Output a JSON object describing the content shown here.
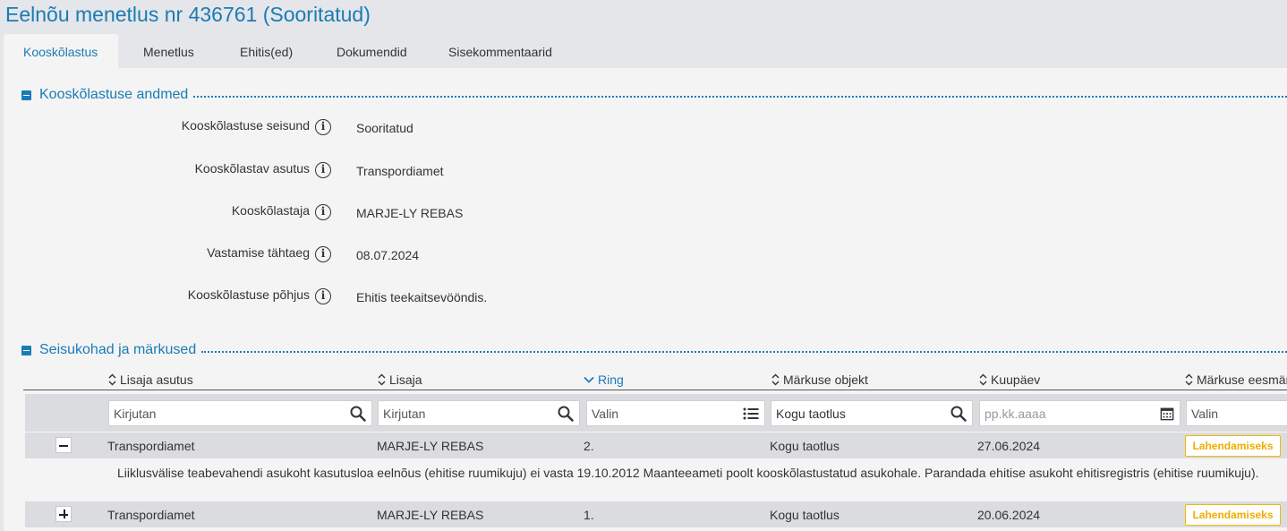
{
  "page": {
    "title": "Eelnõu menetlus nr 436761 (Sooritatud)"
  },
  "tabs": [
    {
      "label": "Kooskõlastus",
      "active": true
    },
    {
      "label": "Menetlus"
    },
    {
      "label": "Ehitis(ed)"
    },
    {
      "label": "Dokumendid"
    },
    {
      "label": "Sisekommentaarid"
    }
  ],
  "section_details": {
    "title": "Kooskõlastuse andmed",
    "fields": [
      {
        "label": "Kooskõlastuse seisund",
        "value": "Sooritatud"
      },
      {
        "label": "Kooskõlastav asutus",
        "value": "Transpordiamet"
      },
      {
        "label": "Kooskõlastaja",
        "value": "MARJE-LY REBAS"
      },
      {
        "label": "Vastamise tähtaeg",
        "value": "08.07.2024"
      },
      {
        "label": "Kooskõlastuse põhjus",
        "value": "Ehitis teekaitsevööndis."
      }
    ]
  },
  "section_remarks": {
    "title": "Seisukohad ja märkused",
    "columns": [
      {
        "label": "Lisaja asutus"
      },
      {
        "label": "Lisaja"
      },
      {
        "label": "Ring",
        "sorted": "desc"
      },
      {
        "label": "Märkuse objekt"
      },
      {
        "label": "Kuupäev"
      },
      {
        "label": "Märkuse eesmärk"
      }
    ],
    "filters": [
      {
        "placeholder": "Kirjutan",
        "icon": "search-icon"
      },
      {
        "placeholder": "Kirjutan",
        "icon": "search-icon"
      },
      {
        "placeholder": "Valin",
        "icon": "list-icon"
      },
      {
        "value": "Kogu taotlus",
        "icon": "search-icon"
      },
      {
        "placeholder": "pp.kk.aaaa",
        "icon": "calendar-icon"
      },
      {
        "placeholder": "Valin"
      }
    ],
    "rows": [
      {
        "expanded": true,
        "asutus": "Transpordiamet",
        "lisaja": "MARJE-LY REBAS",
        "ring": "2.",
        "objekt": "Kogu taotlus",
        "kuupaev": "27.06.2024",
        "eesmark": "Lahendamiseks",
        "comment": "Liiklusvälise teabevahendi asukoht kasutusloa eelnõus (ehitise ruumikuju) ei vasta 19.10.2012 Maanteeameti poolt kooskõlastustatud asukohale. Parandada ehitise asukoht ehitisregistris (ehitise ruumikuju)."
      },
      {
        "expanded": false,
        "asutus": "Transpordiamet",
        "lisaja": "MARJE-LY REBAS",
        "ring": "1.",
        "objekt": "Kogu taotlus",
        "kuupaev": "20.06.2024",
        "eesmark": "Lahendamiseks"
      }
    ]
  },
  "colors": {
    "accent": "#1b7bb5",
    "badge": "#f0ad00"
  }
}
